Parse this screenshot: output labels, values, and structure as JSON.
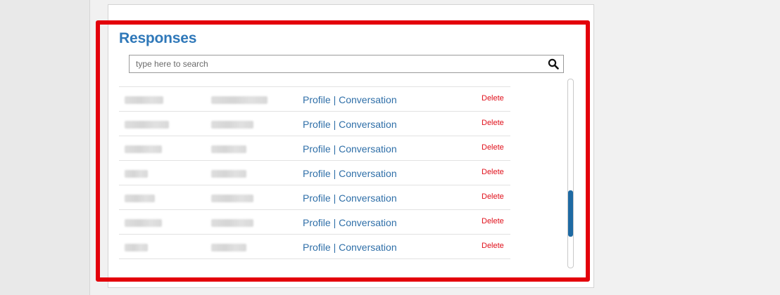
{
  "responses": {
    "title": "Responses",
    "search_placeholder": "type here to search",
    "rows": [
      {
        "profile_label": "Profile",
        "separator": "|",
        "conversation_label": "Conversation",
        "delete_label": "Delete"
      },
      {
        "profile_label": "Profile",
        "separator": "|",
        "conversation_label": "Conversation",
        "delete_label": "Delete"
      },
      {
        "profile_label": "Profile",
        "separator": "|",
        "conversation_label": "Conversation",
        "delete_label": "Delete"
      },
      {
        "profile_label": "Profile",
        "separator": "|",
        "conversation_label": "Conversation",
        "delete_label": "Delete"
      },
      {
        "profile_label": "Profile",
        "separator": "|",
        "conversation_label": "Conversation",
        "delete_label": "Delete"
      },
      {
        "profile_label": "Profile",
        "separator": "|",
        "conversation_label": "Conversation",
        "delete_label": "Delete"
      },
      {
        "profile_label": "Profile",
        "separator": "|",
        "conversation_label": "Conversation",
        "delete_label": "Delete"
      }
    ],
    "scroll_position_fraction": 0.78
  },
  "colors": {
    "title": "#2f78b9",
    "link": "#2f6fa8",
    "delete": "#e0101b",
    "highlight_border": "#e3000b",
    "scroll_thumb": "#1e6aa3"
  },
  "icons": {
    "search": "search-icon"
  }
}
